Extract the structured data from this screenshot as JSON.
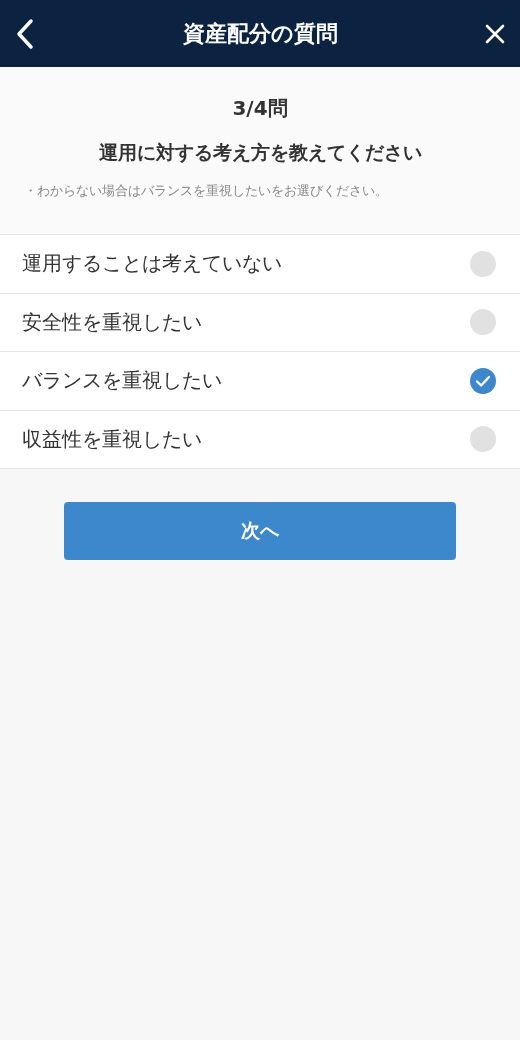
{
  "header": {
    "title": "資産配分の質問"
  },
  "question": {
    "progress": "3/4問",
    "text": "運用に対する考え方を教えてください",
    "hint": "・わからない場合はバランスを重視したいをお選びください。"
  },
  "options": [
    {
      "label": "運用することは考えていない",
      "selected": false
    },
    {
      "label": "安全性を重視したい",
      "selected": false
    },
    {
      "label": "バランスを重視したい",
      "selected": true
    },
    {
      "label": "収益性を重視したい",
      "selected": false
    }
  ],
  "next_button": {
    "label": "次へ"
  }
}
